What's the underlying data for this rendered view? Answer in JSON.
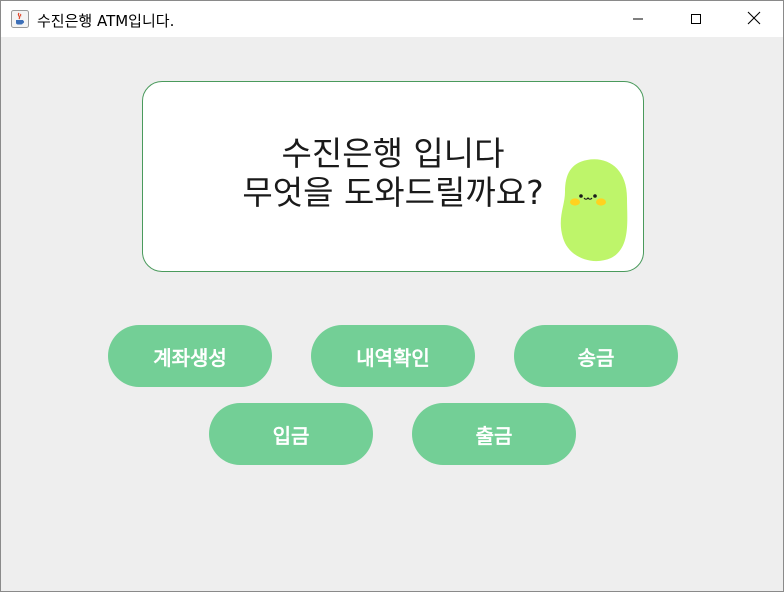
{
  "window": {
    "title": "수진은행 ATM입니다.",
    "app_icon": "java-coffee-icon",
    "controls": {
      "minimize_icon": "minimize-icon",
      "maximize_icon": "maximize-icon",
      "close_icon": "close-icon"
    }
  },
  "message": {
    "line1": "수진은행 입니다",
    "line2": "무엇을 도와드릴까요?",
    "mascot": "bean-character-icon"
  },
  "buttons": {
    "create_account": "계좌생성",
    "check_history": "내역확인",
    "transfer": "송금",
    "deposit": "입금",
    "withdraw": "출금"
  },
  "colors": {
    "button_bg": "#73cf96",
    "button_text": "#ffffff",
    "panel_border": "#4a9a5c",
    "mascot_body": "#bef56a",
    "window_bg": "#eeeeee"
  }
}
